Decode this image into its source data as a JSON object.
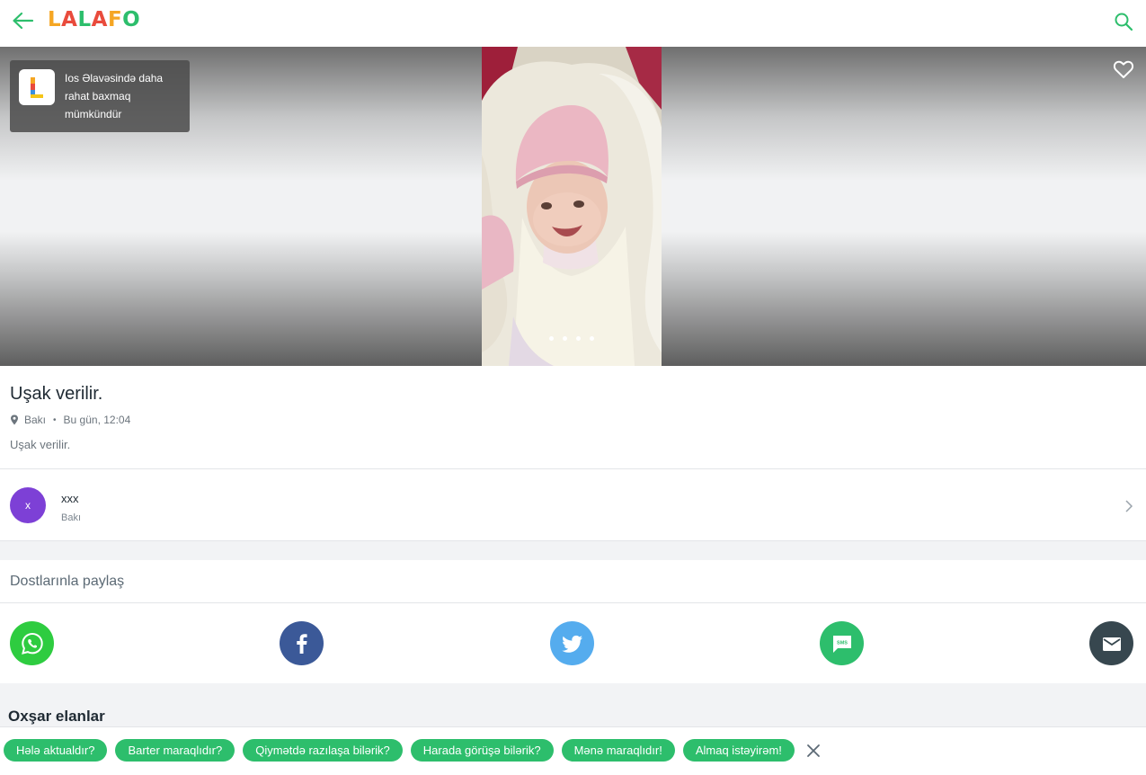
{
  "header": {
    "logo_letters": [
      "L",
      "A",
      "L",
      "A",
      "F",
      "O"
    ],
    "logo_colors": [
      "#f5a623",
      "#e94b3c",
      "#2dbe6c",
      "#e94b3c",
      "#f5a623",
      "#2dbe6c"
    ],
    "accent": "#2dbe6c"
  },
  "gallery": {
    "ios_banner_text": "Ios Əlavəsində daha rahat baxmaq mümkündür",
    "slides": 4
  },
  "ad": {
    "title": "Uşak verilir.",
    "location": "Bakı",
    "time": "Bu gün, 12:04",
    "description": "Uşak verilir."
  },
  "seller": {
    "avatar_letter": "x",
    "avatar_color": "#7d40d6",
    "name": "xxx",
    "city": "Bakı"
  },
  "share": {
    "title": "Dostlarınla paylaş",
    "buttons": [
      {
        "name": "whatsapp",
        "color": "#2ecc40"
      },
      {
        "name": "facebook",
        "color": "#3b5998"
      },
      {
        "name": "twitter",
        "color": "#55acee"
      },
      {
        "name": "sms",
        "color": "#2dbe6c",
        "label": "SMS"
      },
      {
        "name": "email",
        "color": "#37474f"
      }
    ]
  },
  "similar": {
    "title": "Oxşar elanlar"
  },
  "quick_replies": [
    "Hələ aktualdır?",
    "Barter maraqlıdır?",
    "Qiymətdə razılaşa bilərik?",
    "Harada görüşə bilərik?",
    "Mənə maraqlıdır!",
    "Almaq istəyirəm!"
  ]
}
